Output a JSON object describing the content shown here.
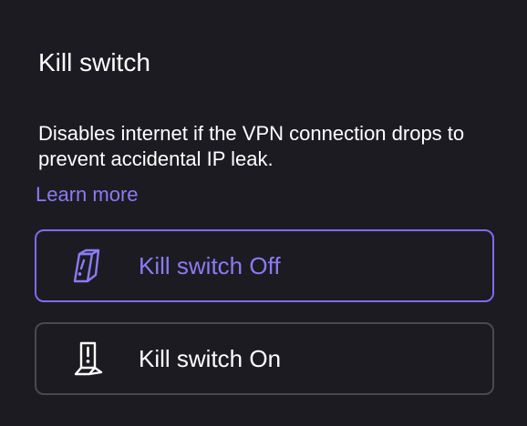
{
  "section": {
    "title": "Kill switch",
    "description": "Disables internet if the VPN connection drops to prevent accidental IP leak.",
    "learn_more": "Learn more"
  },
  "options": [
    {
      "label": "Kill switch Off",
      "icon": "switch-off-icon",
      "selected": true
    },
    {
      "label": "Kill switch On",
      "icon": "switch-on-icon",
      "selected": false
    }
  ],
  "colors": {
    "background": "#1c1b22",
    "accent": "#8b7bf3",
    "selected_border": "#7d6bf0",
    "unselected_border": "#4a4950",
    "text": "#ffffff"
  }
}
